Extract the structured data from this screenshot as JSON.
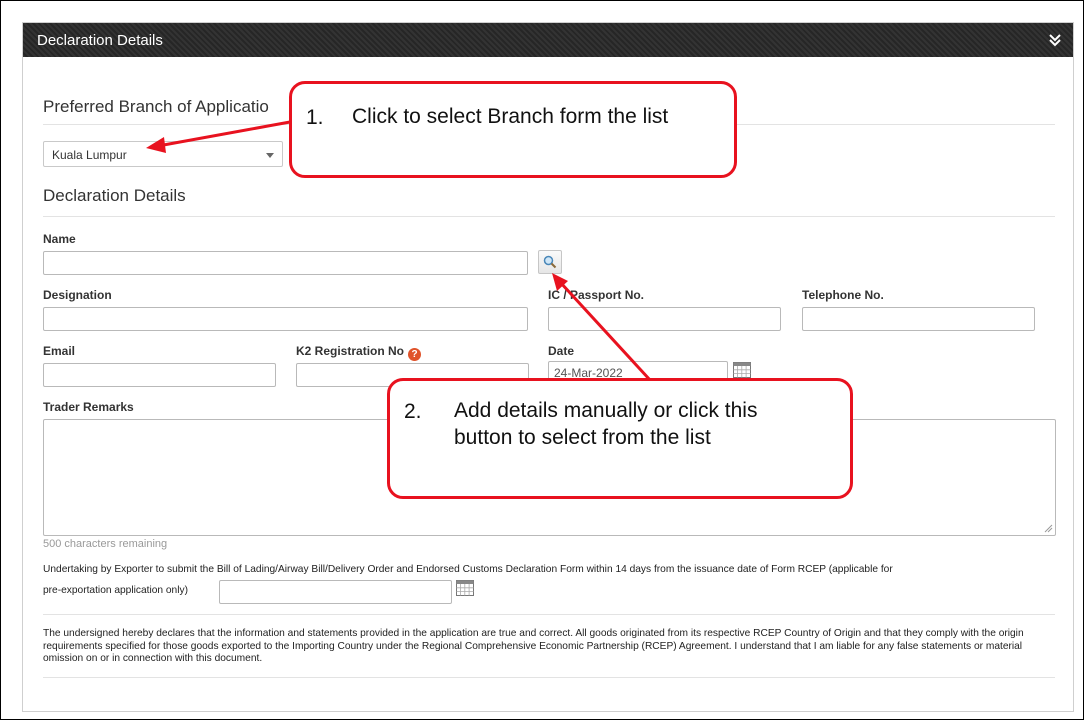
{
  "panel": {
    "title": "Declaration Details"
  },
  "branch_section": {
    "heading": "Preferred Branch of Applicatio",
    "selected_branch": "Kuala Lumpur"
  },
  "declaration_section": {
    "heading": "Declaration Details",
    "name_label": "Name",
    "designation_label": "Designation",
    "ic_passport_label": "IC / Passport No.",
    "telephone_label": "Telephone No.",
    "email_label": "Email",
    "k2_label": "K2 Registration No",
    "date_label": "Date",
    "date_value": "24-Mar-2022",
    "trader_remarks_label": "Trader Remarks",
    "chars_remaining": "500 characters remaining"
  },
  "undertaking": {
    "text_line1": "Undertaking by Exporter to submit the Bill of Lading/Airway Bill/Delivery Order and Endorsed Customs Declaration Form within 14 days from the issuance date of Form RCEP (applicable for",
    "text_line2": "pre-exportation application only)"
  },
  "declaration_text": "The undersigned hereby declares that the information and statements provided in the application are true and correct. All goods originated from its respective RCEP Country of Origin and that they comply with the origin requirements specified for those goods exported to the Importing Country under the Regional Comprehensive Economic Partnership (RCEP) Agreement. I understand that I am liable for any false statements or material omission on or in connection with this document.",
  "callouts": {
    "one": {
      "number": "1.",
      "text": "Click to select Branch form the list"
    },
    "two": {
      "number": "2.",
      "text": "Add details manually or click this button to select from the list"
    }
  },
  "colors": {
    "header_bg": "#2d2d2d",
    "callout_border": "#e8121f",
    "help_icon": "#e0532a"
  },
  "icons": [
    "chevron-double-down-icon",
    "search-icon",
    "calendar-icon",
    "help-icon",
    "resize-grip-icon"
  ]
}
